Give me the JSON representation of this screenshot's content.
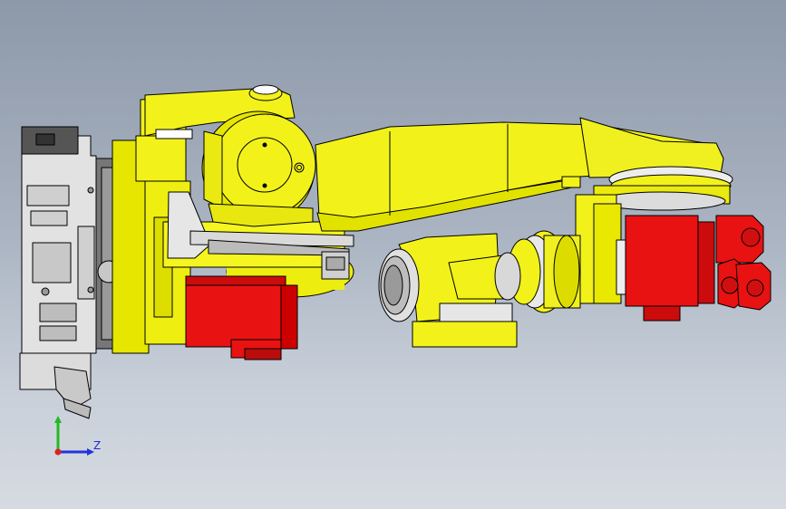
{
  "viewport": {
    "background_top": "#8d98a9",
    "background_bottom": "#d6dbe2"
  },
  "colors": {
    "robot_body": "#f2f21a",
    "motor": "#e81212",
    "base_plate": "#d9d9d9",
    "edge": "#000000"
  },
  "triad": {
    "z_label": "Z",
    "x_color": "#2233dd",
    "y_color": "#22bb22",
    "origin_color": "#dd2222"
  }
}
